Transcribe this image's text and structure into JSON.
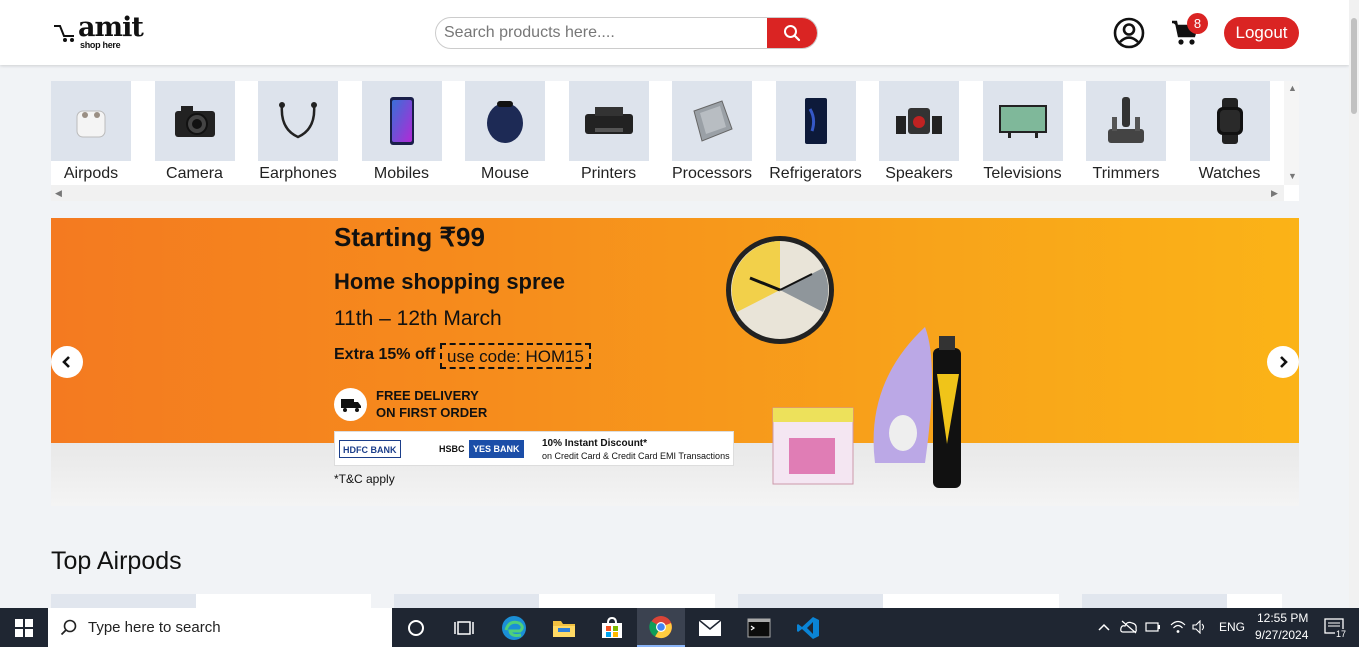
{
  "header": {
    "logo_word": "amit",
    "logo_tag": "shop here",
    "search_placeholder": "Search products here....",
    "cart_count": "8",
    "logout_label": "Logout"
  },
  "categories": [
    {
      "label": "Airpods"
    },
    {
      "label": "Camera"
    },
    {
      "label": "Earphones"
    },
    {
      "label": "Mobiles"
    },
    {
      "label": "Mouse"
    },
    {
      "label": "Printers"
    },
    {
      "label": "Processors"
    },
    {
      "label": "Refrigerators"
    },
    {
      "label": "Speakers"
    },
    {
      "label": "Televisions"
    },
    {
      "label": "Trimmers"
    },
    {
      "label": "Watches"
    }
  ],
  "banner": {
    "title": "Starting ₹99",
    "subtitle": "Home shopping spree",
    "dates": "11th – 12th March",
    "extra": "Extra 15% off",
    "code": "use code: HOM15",
    "delivery_line1": "FREE DELIVERY",
    "delivery_line2": "ON FIRST ORDER",
    "bank1": "HDFC BANK",
    "bank2": "HSBC",
    "bank3": "YES BANK",
    "discount": "10% Instant Discount*",
    "discount_sub": "on Credit Card & Credit Card EMI Transactions",
    "tnc": "*T&C apply"
  },
  "section": {
    "title": "Top Airpods"
  },
  "taskbar": {
    "search_text": "Type here to search",
    "lang": "ENG",
    "time": "12:55 PM",
    "date": "9/27/2024",
    "notif_count": "17"
  }
}
